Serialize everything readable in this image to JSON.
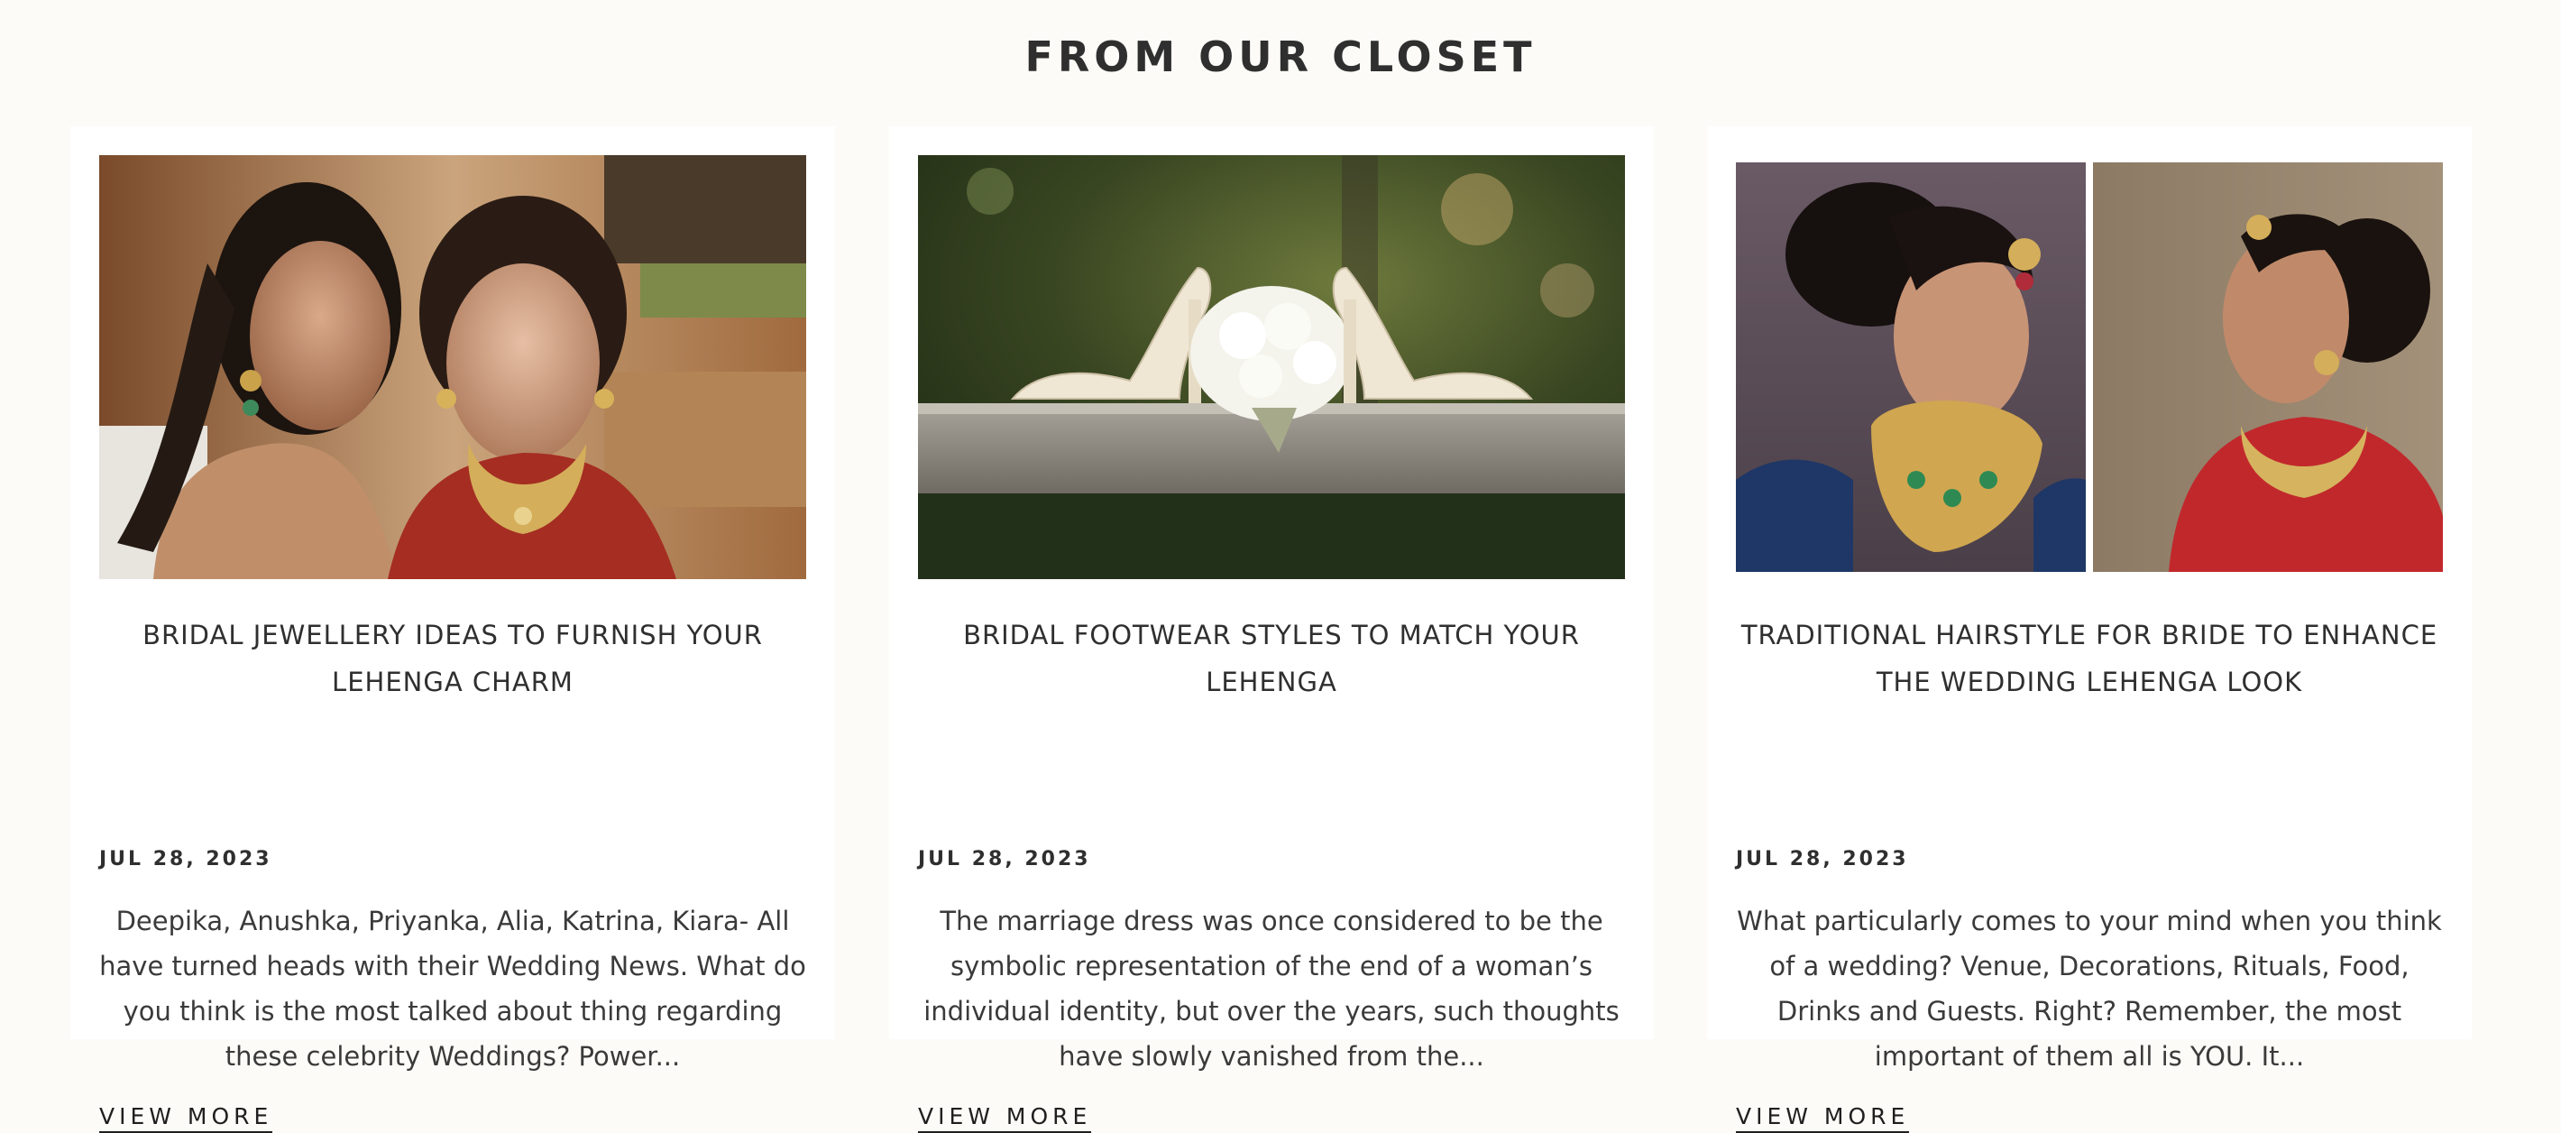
{
  "section": {
    "title": "FROM OUR CLOSET"
  },
  "cards": [
    {
      "title": "BRIDAL JEWELLERY IDEAS TO FURNISH YOUR LEHENGA CHARM",
      "date": "JUL 28, 2023",
      "excerpt": "Deepika, Anushka, Priyanka, Alia, Katrina, Kiara- All have turned heads with their Wedding News. What do you think is the most talked about thing regarding these celebrity Weddings?  Power...",
      "link_label": "VIEW MORE",
      "image_alt": "Two brides wearing heavy gold jewellery"
    },
    {
      "title": "BRIDAL FOOTWEAR STYLES TO MATCH YOUR LEHENGA",
      "date": "JUL 28, 2023",
      "excerpt": "The marriage dress was once considered to be the symbolic representation of the end of a woman’s individual identity, but over the years, such thoughts have slowly vanished from the...",
      "link_label": "VIEW MORE",
      "image_alt": "Cream bridal heels beside a white rose bouquet"
    },
    {
      "title": "TRADITIONAL HAIRSTYLE FOR BRIDE TO ENHANCE THE WEDDING LEHENGA LOOK",
      "date": "JUL 28, 2023",
      "excerpt": "What particularly comes to your mind when you think of a wedding? Venue, Decorations, Rituals, Food, Drinks and Guests. Right? Remember, the most important of them all is YOU. It...",
      "link_label": "VIEW MORE",
      "image_alt": "Bride with traditional bun hairstyle and maang tikka"
    }
  ]
}
